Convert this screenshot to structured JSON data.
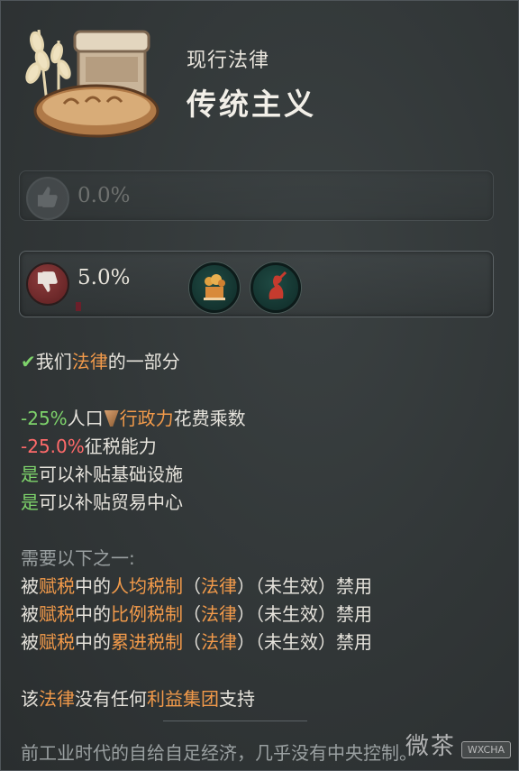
{
  "law": {
    "category": "现行法律",
    "name": "传统主义"
  },
  "approval": {
    "approve_pct": "0.0%",
    "disapprove_pct": "5.0%"
  },
  "icons": {
    "law_icon": "bread-jar-wheat-icon",
    "approve": "thumbs-up-icon",
    "disapprove": "thumbs-down-icon",
    "group_a": "landowners-icon",
    "group_b": "rural-folk-icon",
    "inline_authority": "authority-icon"
  },
  "colors": {
    "highlight": "#f29a4a",
    "positive": "#7ed36b",
    "negative": "#ff6a6a",
    "muted": "#9aa0a1"
  },
  "part_of": {
    "check": "✔",
    "prefix": "我们",
    "law_word": "法律",
    "suffix": "的一部分"
  },
  "effects": [
    {
      "value": "-25%",
      "text1": "人口",
      "keyword": "行政力",
      "text2": "花费乘数"
    },
    {
      "value": "-25.0%",
      "text1": "征税能力"
    },
    {
      "value": "是",
      "text1": "可以补贴基础设施"
    },
    {
      "value": "是",
      "text1": "可以补贴贸易中心"
    }
  ],
  "requirements": {
    "heading": "需要以下之一:",
    "items": [
      {
        "p1": "被",
        "p2": "赋税",
        "p3": "中的",
        "law": "人均税制",
        "lp": "（",
        "lw": "法律",
        "rp": "）",
        "status": "（未生效）禁用"
      },
      {
        "p1": "被",
        "p2": "赋税",
        "p3": "中的",
        "law": "比例税制",
        "lp": "（",
        "lw": "法律",
        "rp": "）",
        "status": "（未生效）禁用"
      },
      {
        "p1": "被",
        "p2": "赋税",
        "p3": "中的",
        "law": "累进税制",
        "lp": "（",
        "lw": "法律",
        "rp": "）",
        "status": "（未生效）禁用"
      }
    ]
  },
  "support": {
    "p1": "该",
    "law_word": "法律",
    "p2": "没有任何",
    "group_word": "利益集团",
    "p3": "支持"
  },
  "description": "前工业时代的自给自足经济，几乎没有中央控制。",
  "watermark": {
    "text": "微茶",
    "badge": "WXCHA"
  }
}
